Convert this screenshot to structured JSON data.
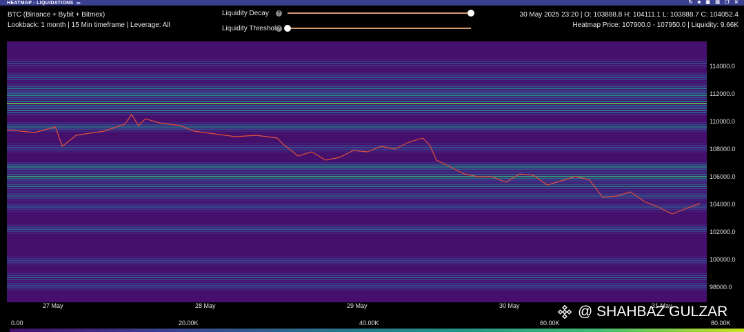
{
  "window": {
    "title": "HEATMAP - LIQUIDATIONS",
    "icons": [
      "sliders-icon",
      "refresh-icon",
      "camera-icon",
      "image-icon",
      "save-icon",
      "window-icon",
      "close-icon"
    ]
  },
  "info_left": {
    "line1": "BTC (Binance + Bybit + Bitmex)",
    "line2": "Lookback: 1 month | 15 Min timeframe | Leverage: All"
  },
  "controls": {
    "decay": {
      "label": "Liquidity Decay",
      "value": 1.0
    },
    "threshold": {
      "label": "Liquidity Threshold",
      "value": 0.0
    }
  },
  "info_right": {
    "line1": "30 May 2025 23:20 | O: 103888.8 H: 104111.1 L: 103888.7 C: 104052.4",
    "line2": "Heatmap Price: 107900.0 - 107950.0 | Liquidity: 9.66K"
  },
  "chart_data": {
    "type": "heatmap",
    "x_labels": [
      "27 May",
      "28 May",
      "29 May",
      "30 May",
      "31 May"
    ],
    "y_ticks": [
      114000,
      112000,
      110000,
      108000,
      106000,
      104000,
      102000,
      100000,
      98000
    ],
    "y_tick_labels": [
      "114000.0",
      "112000.0",
      "110000.0",
      "108000.0",
      "106000.0",
      "104000.0",
      "102000.0",
      "100000.0",
      "98000.0"
    ],
    "ylim": [
      96900,
      115800
    ],
    "price_line": {
      "t": [
        0,
        0.04,
        0.07,
        0.08,
        0.1,
        0.14,
        0.17,
        0.18,
        0.19,
        0.2,
        0.22,
        0.25,
        0.27,
        0.3,
        0.33,
        0.36,
        0.39,
        0.4,
        0.42,
        0.44,
        0.46,
        0.48,
        0.5,
        0.52,
        0.54,
        0.56,
        0.58,
        0.6,
        0.61,
        0.62,
        0.64,
        0.66,
        0.68,
        0.7,
        0.72,
        0.74,
        0.76,
        0.78,
        0.8,
        0.82,
        0.84,
        0.86,
        0.88,
        0.9,
        0.92,
        0.94,
        0.96,
        0.98,
        1.0
      ],
      "price": [
        109400,
        109200,
        109600,
        108200,
        109000,
        109300,
        109800,
        110500,
        109700,
        110200,
        109900,
        109700,
        109300,
        109100,
        108900,
        109000,
        108800,
        108300,
        107500,
        107800,
        107200,
        107400,
        107900,
        107800,
        108200,
        108000,
        108500,
        108800,
        108300,
        107200,
        106700,
        106200,
        106000,
        106000,
        105600,
        106200,
        106100,
        105400,
        105700,
        106000,
        105800,
        104500,
        104600,
        104900,
        104200,
        103800,
        103300,
        103700,
        104050
      ]
    },
    "bands": [
      {
        "price": 114200,
        "intensity": 0.25
      },
      {
        "price": 113200,
        "intensity": 0.35
      },
      {
        "price": 112400,
        "intensity": 0.5
      },
      {
        "price": 111900,
        "intensity": 0.6
      },
      {
        "price": 111300,
        "intensity": 0.85
      },
      {
        "price": 110800,
        "intensity": 0.55
      },
      {
        "price": 109600,
        "intensity": 0.45
      },
      {
        "price": 108100,
        "intensity": 0.3
      },
      {
        "price": 106700,
        "intensity": 0.55
      },
      {
        "price": 106000,
        "intensity": 0.7
      },
      {
        "price": 105300,
        "intensity": 0.5
      },
      {
        "price": 104600,
        "intensity": 0.35
      },
      {
        "price": 103800,
        "intensity": 0.3
      },
      {
        "price": 102200,
        "intensity": 0.35
      },
      {
        "price": 99900,
        "intensity": 0.25
      },
      {
        "price": 98700,
        "intensity": 0.4
      },
      {
        "price": 98100,
        "intensity": 0.3
      }
    ],
    "colorscale": [
      "#45106b",
      "#3b3f8f",
      "#2b6c8e",
      "#20948a",
      "#3fbc72",
      "#c8e020"
    ],
    "colorbar_labels": [
      "0.00",
      "20.00K",
      "40.00K",
      "60.00K",
      "80.00K"
    ]
  },
  "watermark": {
    "text": "@ SHAHBAZ GULZAR"
  }
}
